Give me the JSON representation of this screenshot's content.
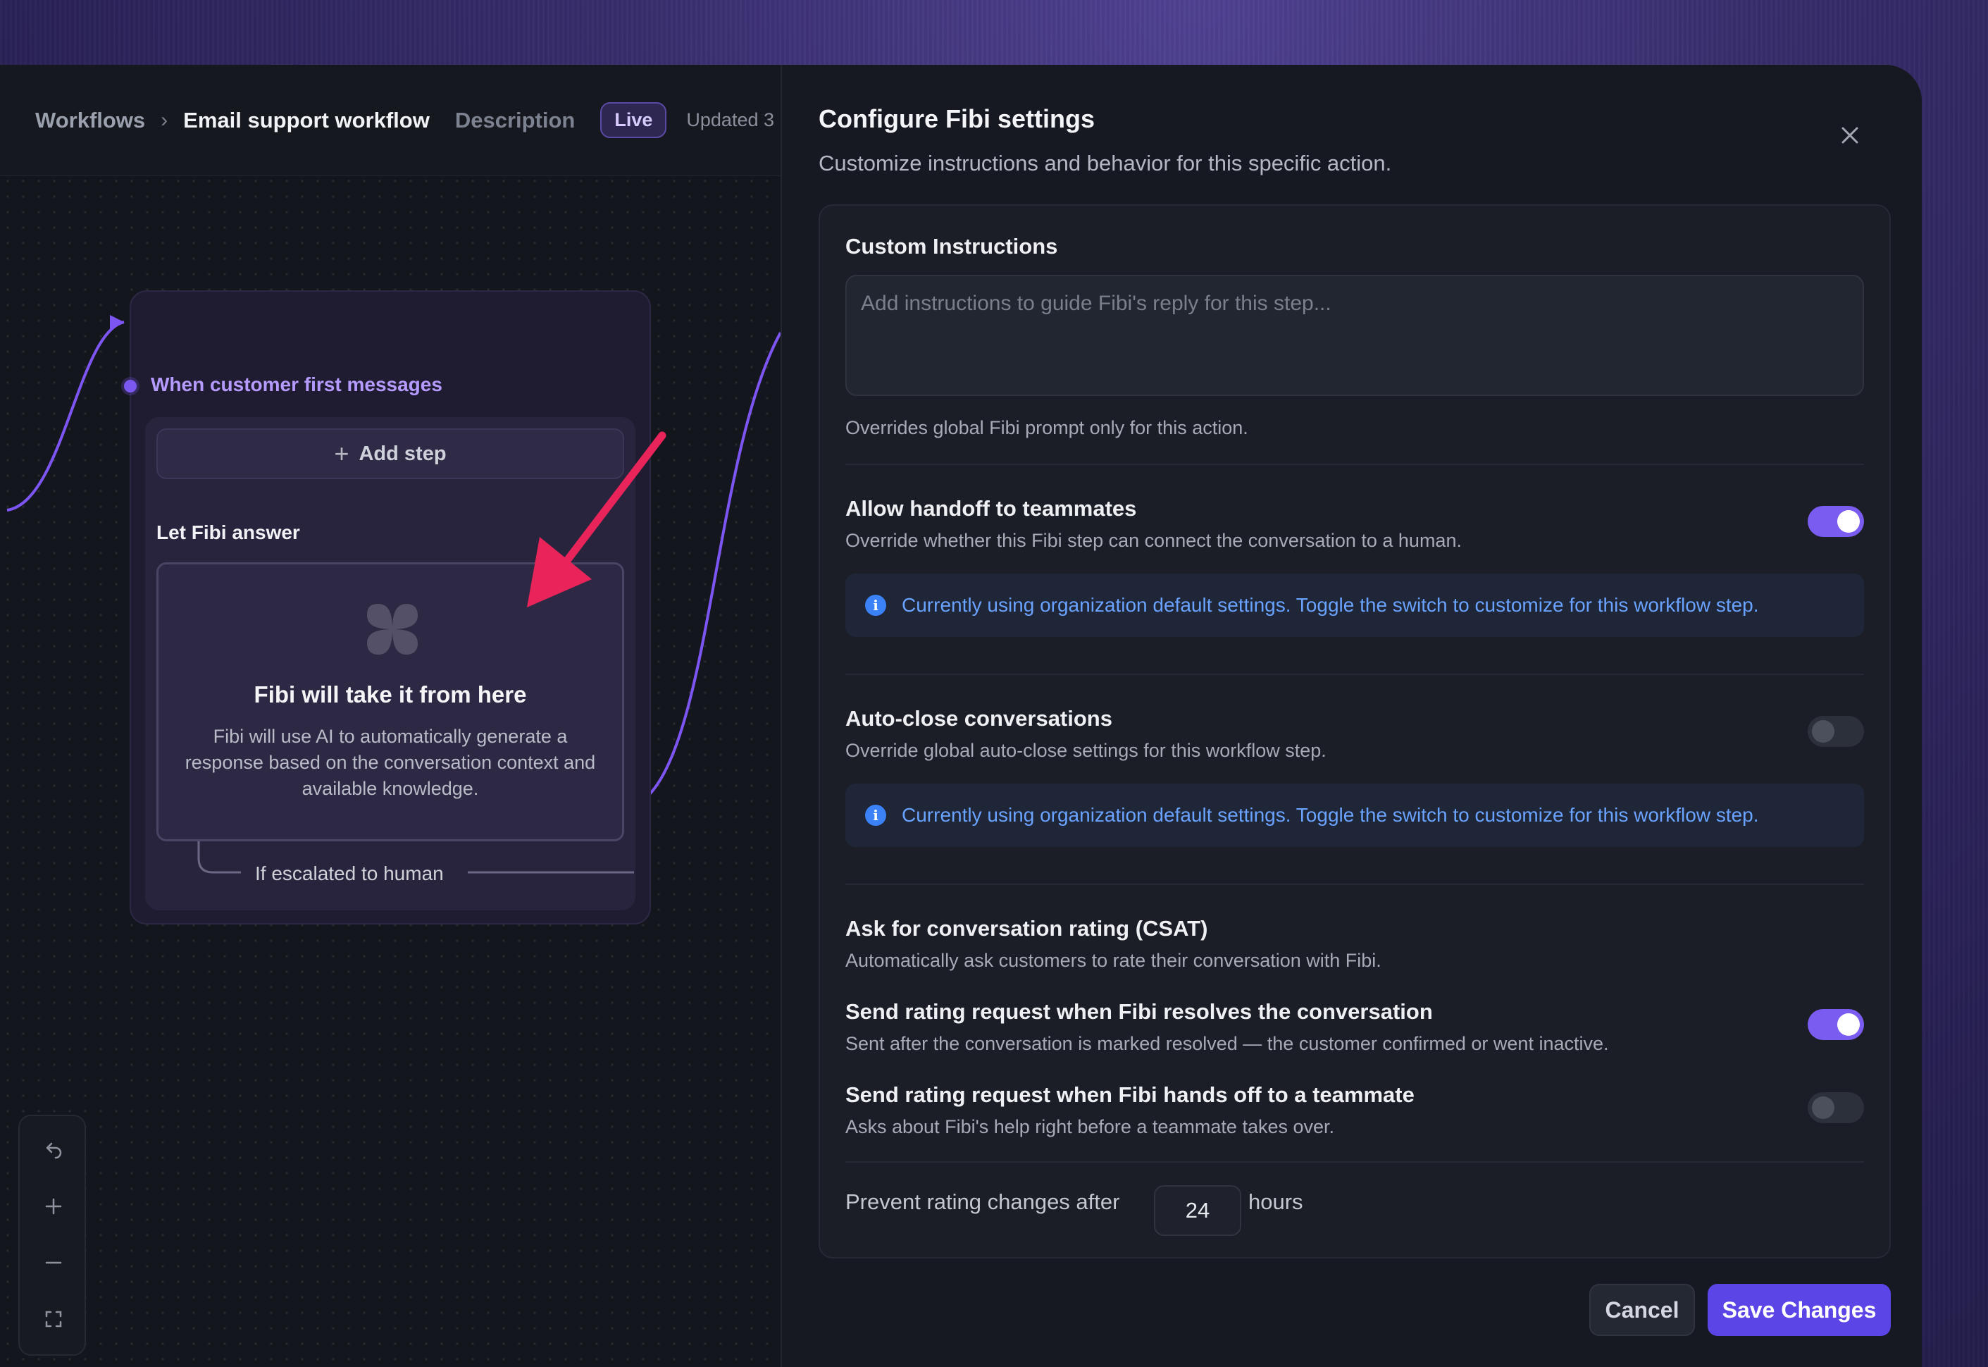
{
  "breadcrumb": {
    "root": "Workflows",
    "separator": "›",
    "current": "Email support workflow",
    "description_link": "Description",
    "status_badge": "Live",
    "updated_text": "Updated 3"
  },
  "canvas": {
    "trigger_label": "When customer first messages",
    "add_step_label": "Add step",
    "section_label": "Let Fibi answer",
    "fibi_card": {
      "title": "Fibi will take it from here",
      "description": "Fibi will use AI to automatically generate a response based on the conversation context and available knowledge."
    },
    "escalation_label": "If escalated to human",
    "annotation_color": "#e8245a",
    "zoom_controls": [
      "undo-icon",
      "zoom-in-icon",
      "zoom-out-icon",
      "fit-view-icon"
    ]
  },
  "panel": {
    "title": "Configure Fibi settings",
    "subtitle": "Customize instructions and behavior for this specific action.",
    "custom_instructions": {
      "label": "Custom Instructions",
      "placeholder": "Add instructions to guide Fibi's reply for this step...",
      "value": "",
      "hint": "Overrides global Fibi prompt only for this action."
    },
    "handoff": {
      "label": "Allow handoff to teammates",
      "description": "Override whether this Fibi step can connect the conversation to a human.",
      "enabled": true,
      "info": "Currently using organization default settings. Toggle the switch to customize for this workflow step."
    },
    "auto_close": {
      "label": "Auto-close conversations",
      "description": "Override global auto-close settings for this workflow step.",
      "enabled": false,
      "info": "Currently using organization default settings. Toggle the switch to customize for this workflow step."
    },
    "csat": {
      "label": "Ask for conversation rating (CSAT)",
      "description": "Automatically ask customers to rate their conversation with Fibi.",
      "on_resolve": {
        "label": "Send rating request when Fibi resolves the conversation",
        "description": "Sent after the conversation is marked resolved — the customer confirmed or went inactive.",
        "enabled": true
      },
      "on_handoff": {
        "label": "Send rating request when Fibi hands off to a teammate",
        "description": "Asks about Fibi's help right before a teammate takes over.",
        "enabled": false
      },
      "prevent_changes_prefix": "Prevent rating changes after",
      "prevent_changes_value": "24",
      "prevent_changes_suffix": "hours"
    },
    "cancel_label": "Cancel",
    "save_label": "Save Changes",
    "accent_color": "#5b45e6",
    "toggle_on_color": "#7a5cf0",
    "info_color": "#6aa3ff"
  }
}
